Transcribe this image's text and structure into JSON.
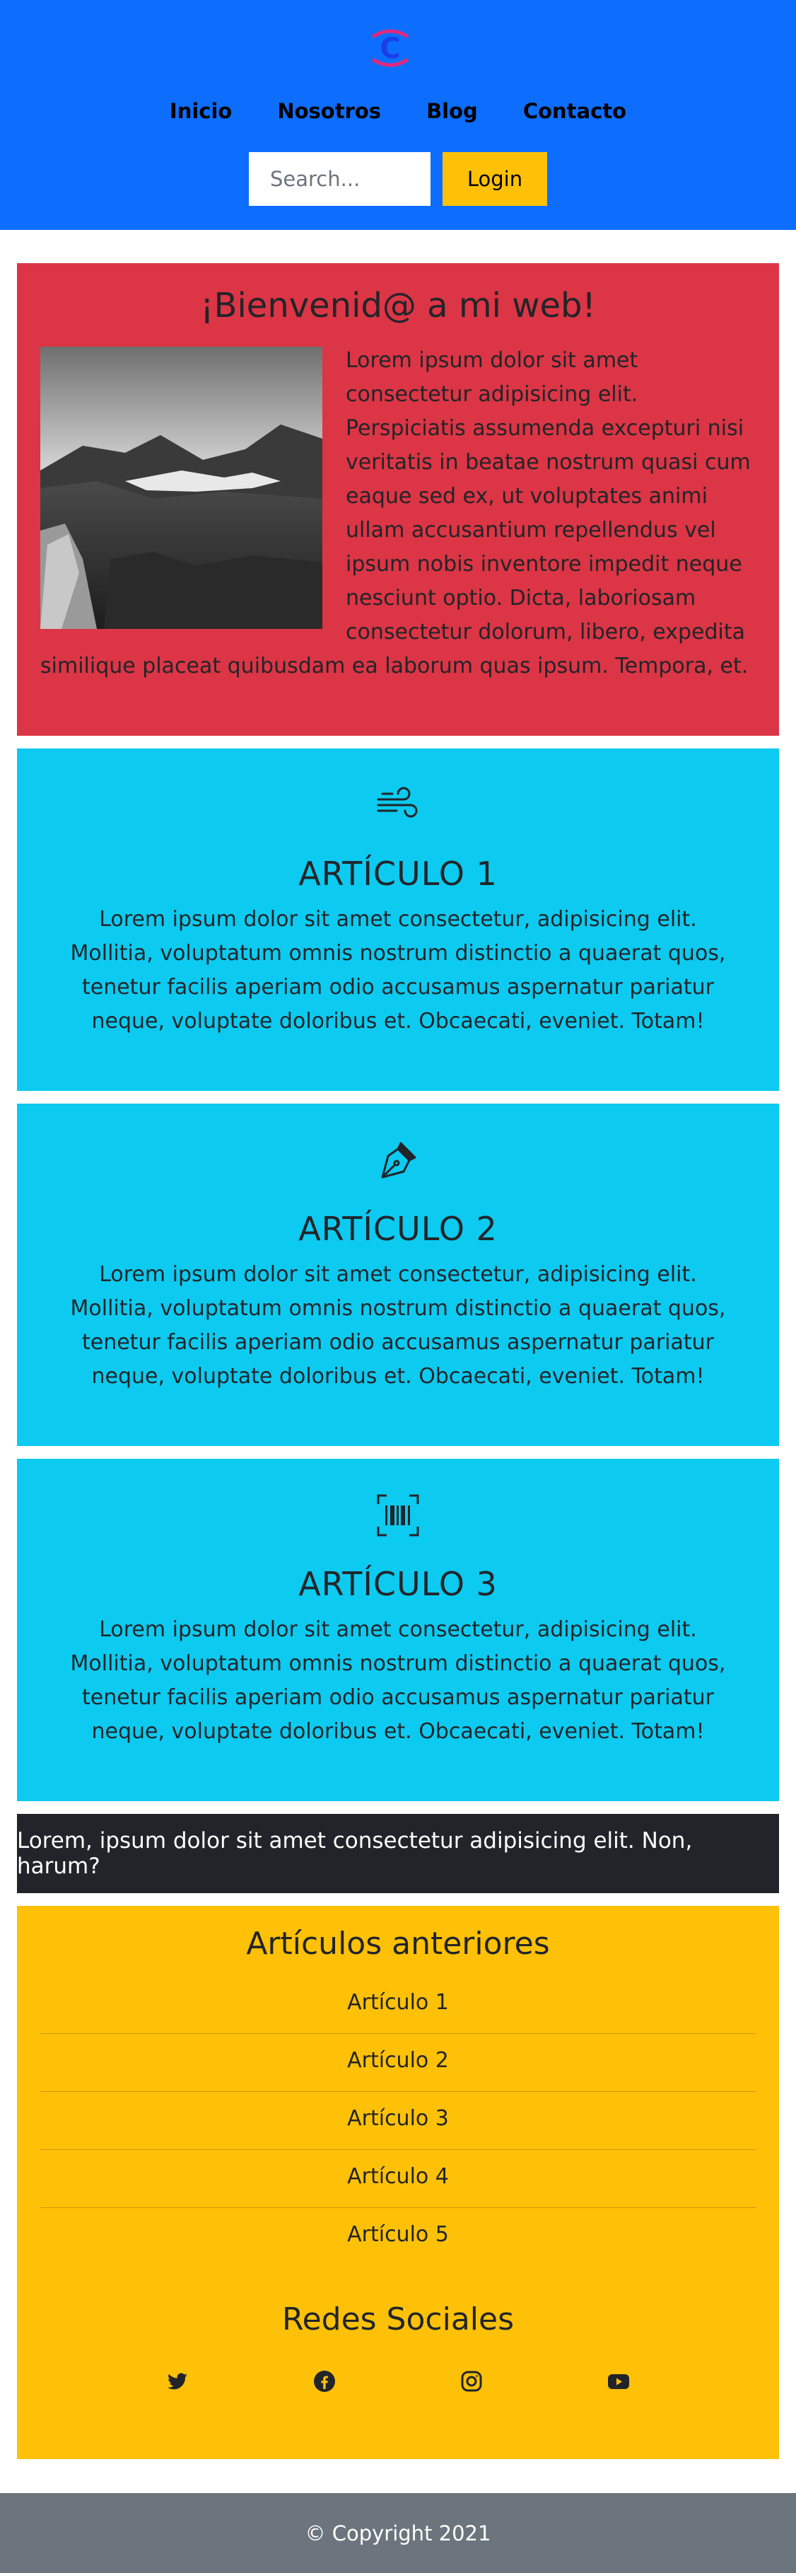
{
  "header": {
    "logo_letter": "C",
    "nav": [
      "Inicio",
      "Nosotros",
      "Blog",
      "Contacto"
    ],
    "search_placeholder": "Search...",
    "login_label": "Login"
  },
  "welcome": {
    "title": "¡Bienvenid@ a mi web!",
    "text": "Lorem ipsum dolor sit amet consectetur adipisicing elit. Perspiciatis assumenda excepturi nisi veritatis in beatae nostrum quasi cum eaque sed ex, ut voluptates animi ullam accusantium repellendus vel ipsum nobis inventore impedit neque nesciunt optio. Dicta, laboriosam consectetur dolorum, libero, expedita similique placeat quibusdam ea laborum quas ipsum. Tempora, et."
  },
  "articles": [
    {
      "icon": "wind-icon",
      "title": "ARTÍCULO 1",
      "text": "Lorem ipsum dolor sit amet consectetur, adipisicing elit. Mollitia, voluptatum omnis nostrum distinctio a quaerat quos, tenetur facilis aperiam odio accusamus aspernatur pariatur neque, voluptate doloribus et. Obcaecati, eveniet. Totam!"
    },
    {
      "icon": "pen-nib-icon",
      "title": "ARTÍCULO 2",
      "text": "Lorem ipsum dolor sit amet consectetur, adipisicing elit. Mollitia, voluptatum omnis nostrum distinctio a quaerat quos, tenetur facilis aperiam odio accusamus aspernatur pariatur neque, voluptate doloribus et. Obcaecati, eveniet. Totam!"
    },
    {
      "icon": "barcode-scan-icon",
      "title": "ARTÍCULO 3",
      "text": "Lorem ipsum dolor sit amet consectetur, adipisicing elit. Mollitia, voluptatum omnis nostrum distinctio a quaerat quos, tenetur facilis aperiam odio accusamus aspernatur pariatur neque, voluptate doloribus et. Obcaecati, eveniet. Totam!"
    }
  ],
  "banner": {
    "text": "Lorem, ipsum dolor sit amet consectetur adipisicing elit. Non, harum?"
  },
  "previous": {
    "title": "Artículos anteriores",
    "items": [
      "Artículo 1",
      "Artículo 2",
      "Artículo 3",
      "Artículo 4",
      "Artículo 5"
    ]
  },
  "social": {
    "title": "Redes Sociales",
    "icons": [
      "twitter-icon",
      "facebook-icon",
      "instagram-icon",
      "youtube-icon"
    ]
  },
  "footer": {
    "text": "© Copyright 2021"
  },
  "colors": {
    "header_bg": "#0d6efd",
    "welcome_bg": "#dc3545",
    "article_bg": "#0dcaf0",
    "banner_bg": "#212529",
    "yellow_bg": "#ffc107",
    "footer_bg": "#6c757d",
    "logo_magenta": "#e0287d",
    "logo_blue": "#1a3ee8"
  }
}
